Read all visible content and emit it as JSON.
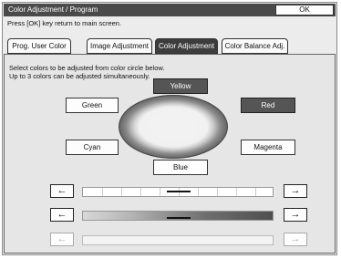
{
  "header": {
    "title": "Color Adjustment / Program",
    "ok_label": "OK",
    "help_text": "Press [OK] key return to main screen."
  },
  "tabs": [
    {
      "label": "Prog. User Color",
      "active": false
    },
    {
      "label": "Image Adjustment",
      "active": false
    },
    {
      "label": "Color Adjustment",
      "active": true
    },
    {
      "label": "Color Balance Adj.",
      "active": false
    }
  ],
  "instructions": {
    "line1": "Select colors to be adjusted from color circle below.",
    "line2": "Up to 3 colors can be adjusted simultaneously."
  },
  "colors": {
    "yellow": {
      "label": "Yellow",
      "selected": true
    },
    "green": {
      "label": "Green",
      "selected": false
    },
    "red": {
      "label": "Red",
      "selected": true
    },
    "cyan": {
      "label": "Cyan",
      "selected": false
    },
    "magenta": {
      "label": "Magenta",
      "selected": false
    },
    "blue": {
      "label": "Blue",
      "selected": false
    }
  },
  "sliders": [
    {
      "name": "hue",
      "left_icon": "arrow-left-icon",
      "right_icon": "arrow-right-icon",
      "enabled": true
    },
    {
      "name": "saturation",
      "left_icon": "arrow-left-icon",
      "right_icon": "arrow-right-icon",
      "enabled": true
    },
    {
      "name": "lightness",
      "left_icon": "arrow-left-icon",
      "right_icon": "arrow-right-icon",
      "enabled": false
    }
  ],
  "theme": {
    "titlebar": "#4a4a4a",
    "active_tab": "#3d3d3d",
    "selected_color": "#555555"
  }
}
